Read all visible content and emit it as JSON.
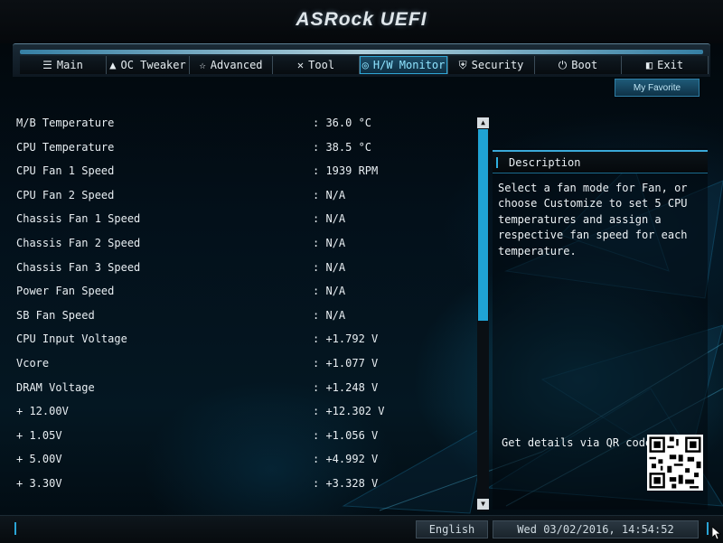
{
  "header": {
    "logo": "ASRock UEFI"
  },
  "tabs": [
    {
      "label": "Main",
      "icon": "list-icon",
      "active": false
    },
    {
      "label": "OC Tweaker",
      "icon": "rocket-icon",
      "active": false
    },
    {
      "label": "Advanced",
      "icon": "star-icon",
      "active": false
    },
    {
      "label": "Tool",
      "icon": "wrench-icon",
      "active": false
    },
    {
      "label": "H/W Monitor",
      "icon": "globe-icon",
      "active": true
    },
    {
      "label": "Security",
      "icon": "shield-icon",
      "active": false
    },
    {
      "label": "Boot",
      "icon": "power-icon",
      "active": false
    },
    {
      "label": "Exit",
      "icon": "exit-icon",
      "active": false
    }
  ],
  "favorite": {
    "label": "My Favorite"
  },
  "monitor": [
    {
      "label": "M/B Temperature",
      "value": ": 36.0 °C"
    },
    {
      "label": "CPU Temperature",
      "value": ": 38.5 °C"
    },
    {
      "label": "CPU Fan 1 Speed",
      "value": ": 1939 RPM"
    },
    {
      "label": "CPU Fan 2 Speed",
      "value": ": N/A"
    },
    {
      "label": "Chassis Fan 1 Speed",
      "value": ": N/A"
    },
    {
      "label": "Chassis Fan 2 Speed",
      "value": ": N/A"
    },
    {
      "label": "Chassis Fan 3 Speed",
      "value": ": N/A"
    },
    {
      "label": "Power Fan Speed",
      "value": ": N/A"
    },
    {
      "label": "SB Fan Speed",
      "value": ": N/A"
    },
    {
      "label": "CPU Input Voltage",
      "value": ": +1.792 V"
    },
    {
      "label": "Vcore",
      "value": ": +1.077 V"
    },
    {
      "label": "DRAM Voltage",
      "value": ": +1.248 V"
    },
    {
      "label": "+ 12.00V",
      "value": ": +12.302 V"
    },
    {
      "label": "+ 1.05V",
      "value": ": +1.056 V"
    },
    {
      "label": "+ 5.00V",
      "value": ": +4.992 V"
    },
    {
      "label": "+ 3.30V",
      "value": ": +3.328 V"
    }
  ],
  "description": {
    "title": "Description",
    "text": "Select a fan mode for Fan, or choose Customize to set 5 CPU temperatures and assign a respective fan speed for each temperature.",
    "qr_label": "Get details via QR code"
  },
  "footer": {
    "language": "English",
    "datetime": "Wed 03/02/2016, 14:54:52"
  }
}
